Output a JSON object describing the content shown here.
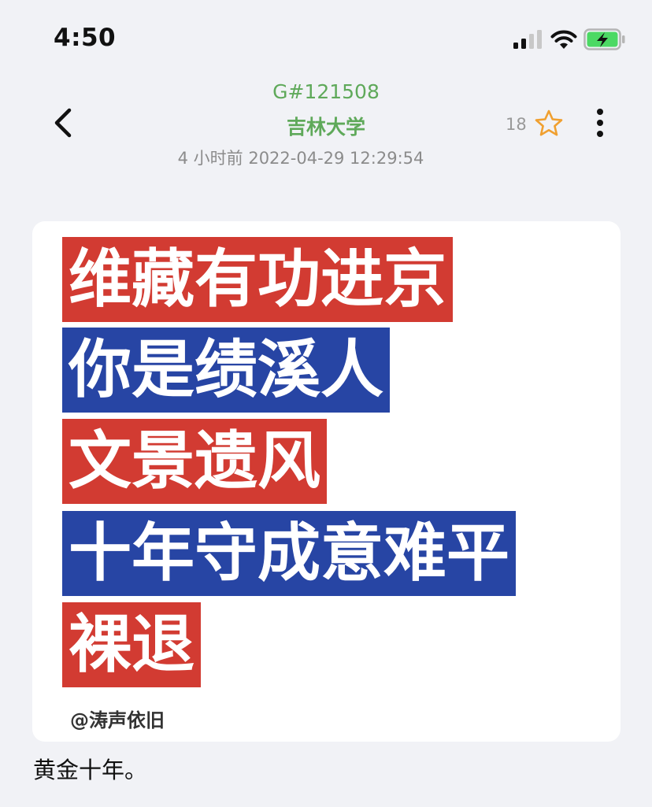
{
  "status_bar": {
    "time": "4:50",
    "icons": [
      "signal-icon",
      "wifi-icon",
      "battery-charging-icon"
    ],
    "battery_color": "#4cd964"
  },
  "header": {
    "post_id": "G#121508",
    "forum_name": "吉林大学",
    "post_time": "4 小时前 2022-04-29 12:29:54",
    "star_count": "18",
    "accent_color": "#5fa95a",
    "star_color": "#f0a030",
    "icons": [
      "back-arrow-icon",
      "star-icon",
      "more-vertical-icon"
    ]
  },
  "image": {
    "lines": [
      {
        "text": "维藏有功进京",
        "color": "#d23b32"
      },
      {
        "text": "你是绩溪人",
        "color": "#2745a4"
      },
      {
        "text": "文景遗风",
        "color": "#d23b32"
      },
      {
        "text": "十年守成意难平",
        "color": "#2745a4"
      },
      {
        "text": "裸退",
        "color": "#d23b32"
      }
    ],
    "watermark": "@涛声依旧"
  },
  "post": {
    "body": "黄金十年。"
  }
}
